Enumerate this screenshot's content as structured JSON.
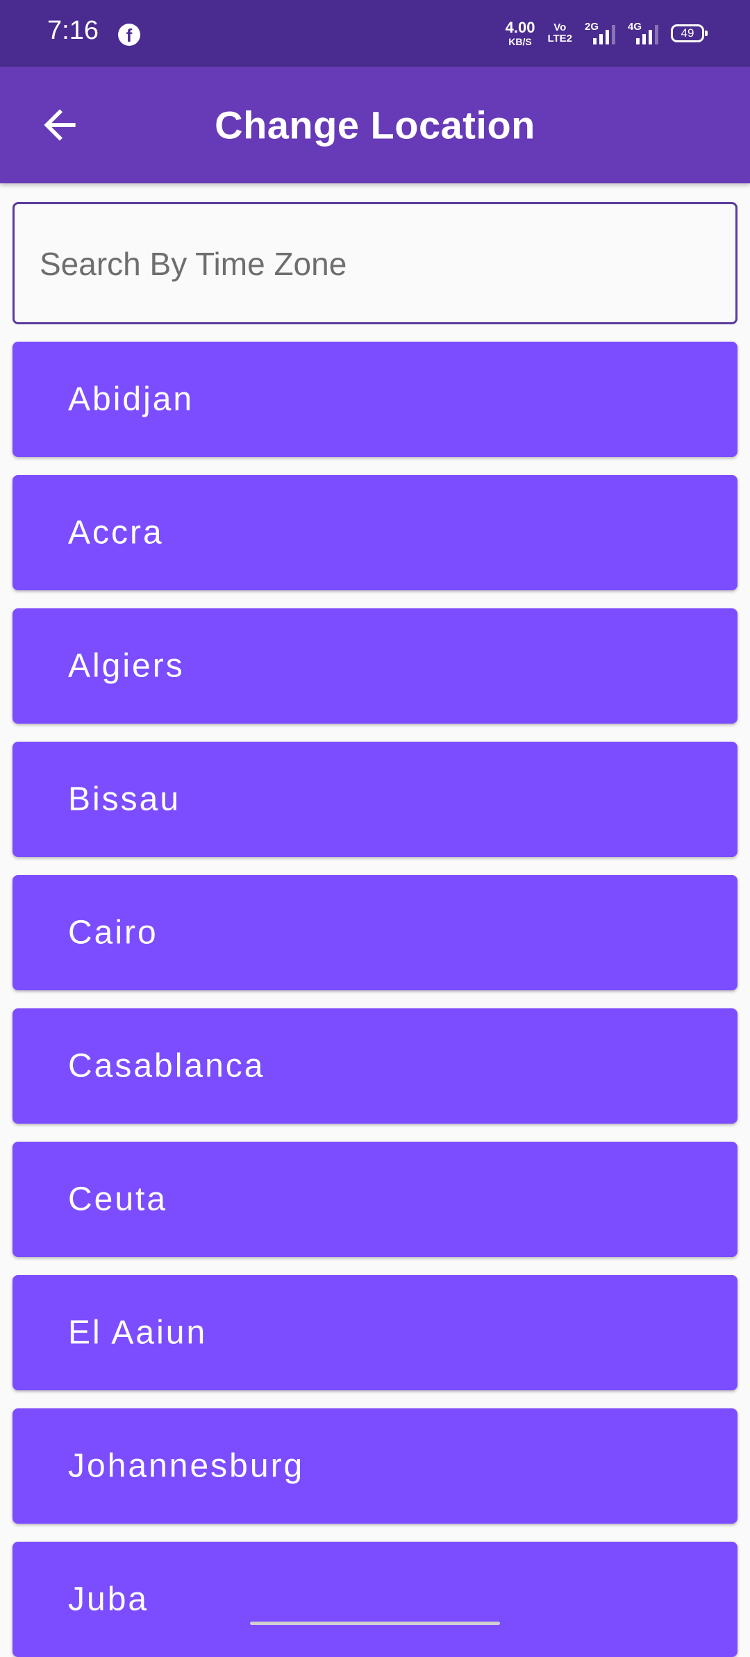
{
  "status_bar": {
    "time": "7:16",
    "app_icon": "facebook-icon",
    "net_speed_value": "4.00",
    "net_speed_unit": "KB/S",
    "volte_top": "Vo",
    "volte_bottom": "LTE2",
    "sim1_type": "2G",
    "sim2_type": "4G",
    "battery_level": "49"
  },
  "app_bar": {
    "title": "Change Location",
    "back_icon": "arrow-left-icon",
    "background": "#673ab7"
  },
  "search": {
    "placeholder": "Search By Time Zone",
    "value": ""
  },
  "locations": {
    "item_color": "#7c4dff",
    "items": [
      {
        "label": "Abidjan"
      },
      {
        "label": "Accra"
      },
      {
        "label": "Algiers"
      },
      {
        "label": "Bissau"
      },
      {
        "label": "Cairo"
      },
      {
        "label": "Casablanca"
      },
      {
        "label": "Ceuta"
      },
      {
        "label": "El Aaiun"
      },
      {
        "label": "Johannesburg"
      },
      {
        "label": "Juba"
      }
    ]
  }
}
